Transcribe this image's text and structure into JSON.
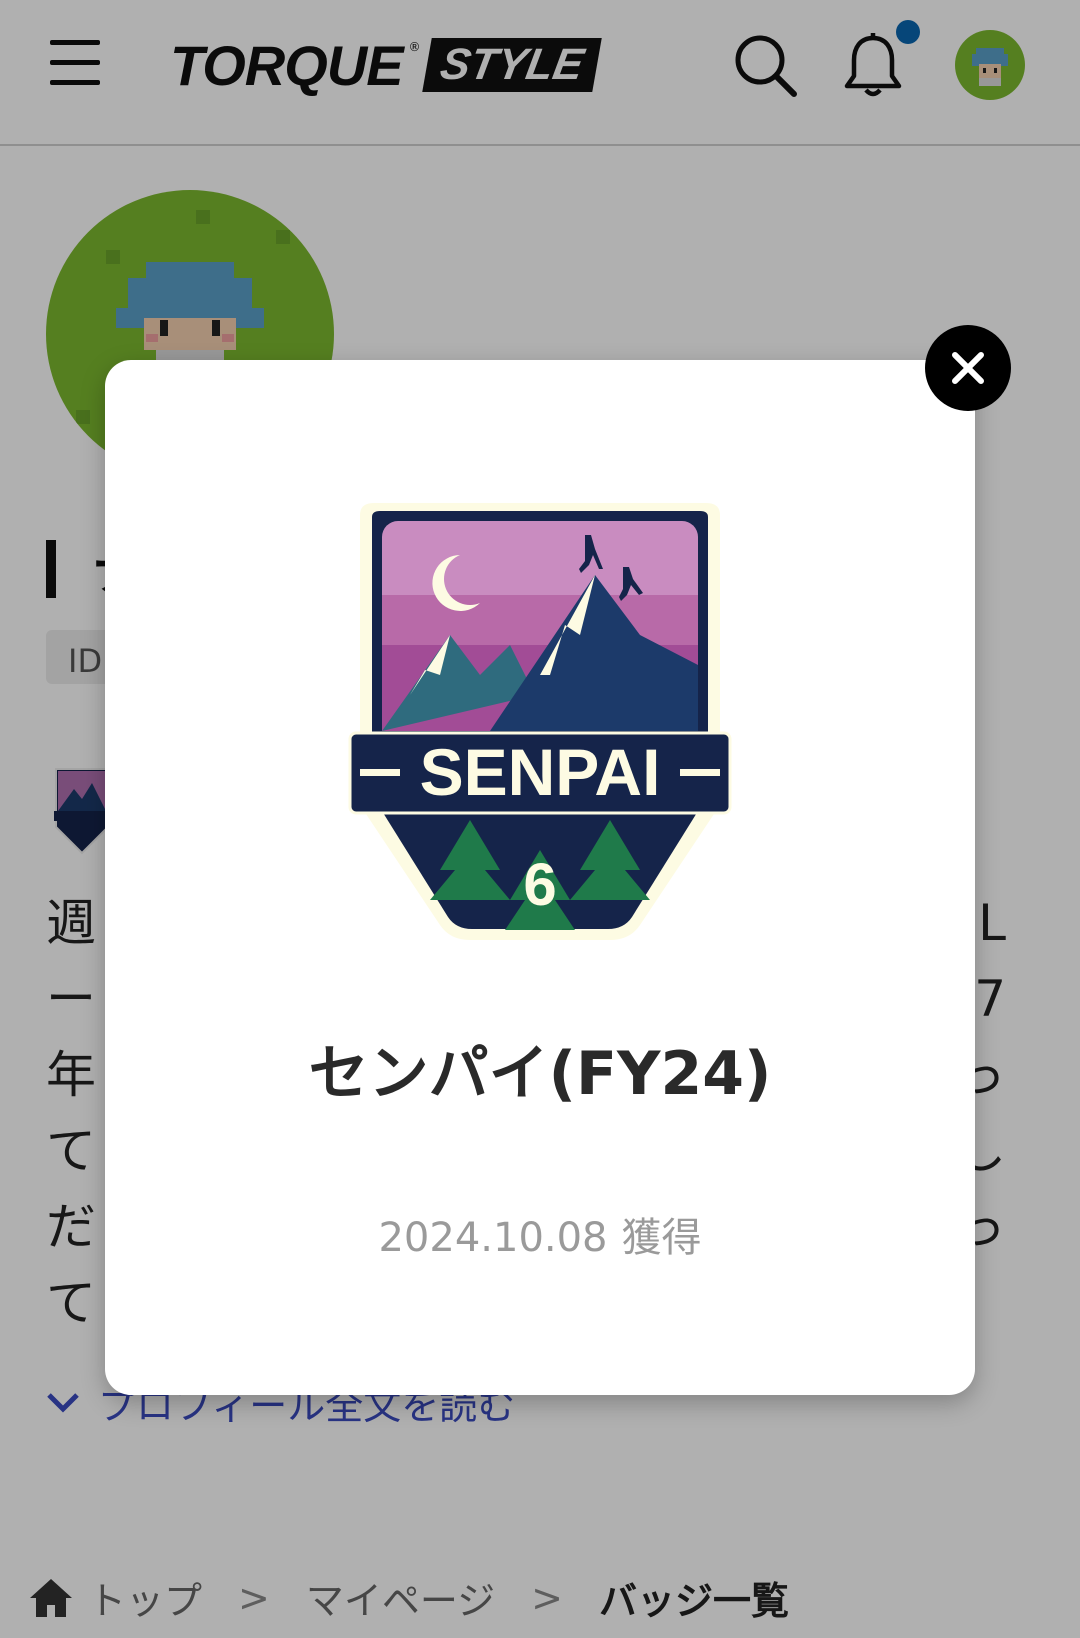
{
  "header": {
    "logo_main": "TORQUE",
    "logo_reg": "®",
    "logo_style": "STYLE",
    "icons": [
      "menu-icon",
      "search-icon",
      "bell-icon",
      "avatar"
    ],
    "notification_dot_color": "#0a66b0"
  },
  "profile": {
    "name_partial": "ナ",
    "id_label": "ID",
    "text_rows": [
      {
        "left": "週",
        "right": "L"
      },
      {
        "left": "ー",
        "right": "7"
      },
      {
        "left": "年",
        "right": "っ"
      },
      {
        "left": "て",
        "right": "し"
      },
      {
        "left": "だ",
        "right": "っ"
      },
      {
        "left": "て",
        "right": ""
      }
    ],
    "read_more": "プロフィール全文を読む"
  },
  "breadcrumb": {
    "items": [
      "トップ",
      "マイページ",
      "バッジ一覧"
    ],
    "separator": ">"
  },
  "modal": {
    "badge_text": "SENPAI",
    "badge_number": "6",
    "title": "センパイ(FY24)",
    "date": "2024.10.08",
    "date_suffix": "獲得",
    "close_icon": "close-icon"
  },
  "colors": {
    "avatar_bg": "#7cb82f",
    "link": "#3b4bc0",
    "badge_navy": "#15244a"
  }
}
